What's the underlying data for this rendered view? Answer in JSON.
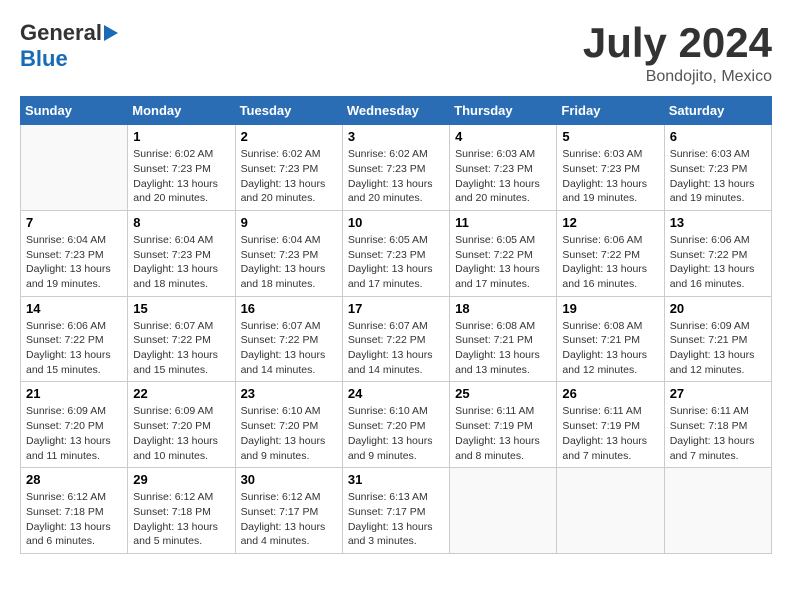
{
  "header": {
    "logo": {
      "general": "General",
      "blue": "Blue"
    },
    "title": "July 2024",
    "location": "Bondojito, Mexico"
  },
  "days_of_week": [
    "Sunday",
    "Monday",
    "Tuesday",
    "Wednesday",
    "Thursday",
    "Friday",
    "Saturday"
  ],
  "weeks": [
    [
      {
        "day": "",
        "sunrise": "",
        "sunset": "",
        "daylight": ""
      },
      {
        "day": "1",
        "sunrise": "Sunrise: 6:02 AM",
        "sunset": "Sunset: 7:23 PM",
        "daylight": "Daylight: 13 hours and 20 minutes."
      },
      {
        "day": "2",
        "sunrise": "Sunrise: 6:02 AM",
        "sunset": "Sunset: 7:23 PM",
        "daylight": "Daylight: 13 hours and 20 minutes."
      },
      {
        "day": "3",
        "sunrise": "Sunrise: 6:02 AM",
        "sunset": "Sunset: 7:23 PM",
        "daylight": "Daylight: 13 hours and 20 minutes."
      },
      {
        "day": "4",
        "sunrise": "Sunrise: 6:03 AM",
        "sunset": "Sunset: 7:23 PM",
        "daylight": "Daylight: 13 hours and 20 minutes."
      },
      {
        "day": "5",
        "sunrise": "Sunrise: 6:03 AM",
        "sunset": "Sunset: 7:23 PM",
        "daylight": "Daylight: 13 hours and 19 minutes."
      },
      {
        "day": "6",
        "sunrise": "Sunrise: 6:03 AM",
        "sunset": "Sunset: 7:23 PM",
        "daylight": "Daylight: 13 hours and 19 minutes."
      }
    ],
    [
      {
        "day": "7",
        "sunrise": "Sunrise: 6:04 AM",
        "sunset": "Sunset: 7:23 PM",
        "daylight": "Daylight: 13 hours and 19 minutes."
      },
      {
        "day": "8",
        "sunrise": "Sunrise: 6:04 AM",
        "sunset": "Sunset: 7:23 PM",
        "daylight": "Daylight: 13 hours and 18 minutes."
      },
      {
        "day": "9",
        "sunrise": "Sunrise: 6:04 AM",
        "sunset": "Sunset: 7:23 PM",
        "daylight": "Daylight: 13 hours and 18 minutes."
      },
      {
        "day": "10",
        "sunrise": "Sunrise: 6:05 AM",
        "sunset": "Sunset: 7:23 PM",
        "daylight": "Daylight: 13 hours and 17 minutes."
      },
      {
        "day": "11",
        "sunrise": "Sunrise: 6:05 AM",
        "sunset": "Sunset: 7:22 PM",
        "daylight": "Daylight: 13 hours and 17 minutes."
      },
      {
        "day": "12",
        "sunrise": "Sunrise: 6:06 AM",
        "sunset": "Sunset: 7:22 PM",
        "daylight": "Daylight: 13 hours and 16 minutes."
      },
      {
        "day": "13",
        "sunrise": "Sunrise: 6:06 AM",
        "sunset": "Sunset: 7:22 PM",
        "daylight": "Daylight: 13 hours and 16 minutes."
      }
    ],
    [
      {
        "day": "14",
        "sunrise": "Sunrise: 6:06 AM",
        "sunset": "Sunset: 7:22 PM",
        "daylight": "Daylight: 13 hours and 15 minutes."
      },
      {
        "day": "15",
        "sunrise": "Sunrise: 6:07 AM",
        "sunset": "Sunset: 7:22 PM",
        "daylight": "Daylight: 13 hours and 15 minutes."
      },
      {
        "day": "16",
        "sunrise": "Sunrise: 6:07 AM",
        "sunset": "Sunset: 7:22 PM",
        "daylight": "Daylight: 13 hours and 14 minutes."
      },
      {
        "day": "17",
        "sunrise": "Sunrise: 6:07 AM",
        "sunset": "Sunset: 7:22 PM",
        "daylight": "Daylight: 13 hours and 14 minutes."
      },
      {
        "day": "18",
        "sunrise": "Sunrise: 6:08 AM",
        "sunset": "Sunset: 7:21 PM",
        "daylight": "Daylight: 13 hours and 13 minutes."
      },
      {
        "day": "19",
        "sunrise": "Sunrise: 6:08 AM",
        "sunset": "Sunset: 7:21 PM",
        "daylight": "Daylight: 13 hours and 12 minutes."
      },
      {
        "day": "20",
        "sunrise": "Sunrise: 6:09 AM",
        "sunset": "Sunset: 7:21 PM",
        "daylight": "Daylight: 13 hours and 12 minutes."
      }
    ],
    [
      {
        "day": "21",
        "sunrise": "Sunrise: 6:09 AM",
        "sunset": "Sunset: 7:20 PM",
        "daylight": "Daylight: 13 hours and 11 minutes."
      },
      {
        "day": "22",
        "sunrise": "Sunrise: 6:09 AM",
        "sunset": "Sunset: 7:20 PM",
        "daylight": "Daylight: 13 hours and 10 minutes."
      },
      {
        "day": "23",
        "sunrise": "Sunrise: 6:10 AM",
        "sunset": "Sunset: 7:20 PM",
        "daylight": "Daylight: 13 hours and 9 minutes."
      },
      {
        "day": "24",
        "sunrise": "Sunrise: 6:10 AM",
        "sunset": "Sunset: 7:20 PM",
        "daylight": "Daylight: 13 hours and 9 minutes."
      },
      {
        "day": "25",
        "sunrise": "Sunrise: 6:11 AM",
        "sunset": "Sunset: 7:19 PM",
        "daylight": "Daylight: 13 hours and 8 minutes."
      },
      {
        "day": "26",
        "sunrise": "Sunrise: 6:11 AM",
        "sunset": "Sunset: 7:19 PM",
        "daylight": "Daylight: 13 hours and 7 minutes."
      },
      {
        "day": "27",
        "sunrise": "Sunrise: 6:11 AM",
        "sunset": "Sunset: 7:18 PM",
        "daylight": "Daylight: 13 hours and 7 minutes."
      }
    ],
    [
      {
        "day": "28",
        "sunrise": "Sunrise: 6:12 AM",
        "sunset": "Sunset: 7:18 PM",
        "daylight": "Daylight: 13 hours and 6 minutes."
      },
      {
        "day": "29",
        "sunrise": "Sunrise: 6:12 AM",
        "sunset": "Sunset: 7:18 PM",
        "daylight": "Daylight: 13 hours and 5 minutes."
      },
      {
        "day": "30",
        "sunrise": "Sunrise: 6:12 AM",
        "sunset": "Sunset: 7:17 PM",
        "daylight": "Daylight: 13 hours and 4 minutes."
      },
      {
        "day": "31",
        "sunrise": "Sunrise: 6:13 AM",
        "sunset": "Sunset: 7:17 PM",
        "daylight": "Daylight: 13 hours and 3 minutes."
      },
      {
        "day": "",
        "sunrise": "",
        "sunset": "",
        "daylight": ""
      },
      {
        "day": "",
        "sunrise": "",
        "sunset": "",
        "daylight": ""
      },
      {
        "day": "",
        "sunrise": "",
        "sunset": "",
        "daylight": ""
      }
    ]
  ]
}
